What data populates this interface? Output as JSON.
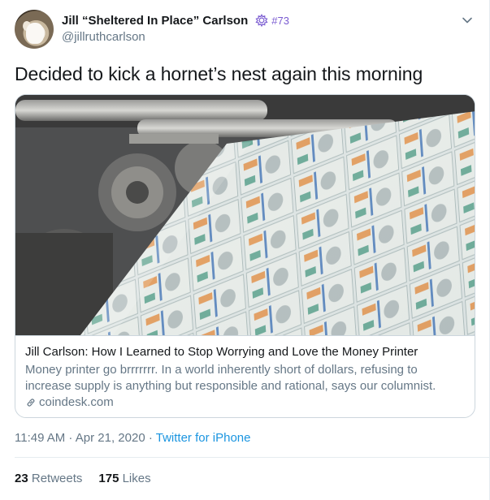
{
  "author": {
    "display_name": "Jill “Sheltered In Place” Carlson",
    "badge_text": "#73",
    "handle": "@jillruthcarlson",
    "badge_icon": "cog-badge-icon",
    "avatar_icon": "dog-avatar"
  },
  "tweet": {
    "text": "Decided to kick a hornet’s nest again this morning"
  },
  "card": {
    "title": "Jill Carlson: How I Learned to Stop Worrying and Love the Money Printer",
    "description": "Money printer go brrrrrrr. In a world inherently short of dollars, refusing to increase supply is anything but responsible and rational, says our columnist.",
    "domain": "coindesk.com",
    "link_icon": "link-icon",
    "image_subject": "money-printing-press"
  },
  "meta": {
    "time": "11:49 AM",
    "separator1": " · ",
    "date": "Apr 21, 2020",
    "separator2": " · ",
    "source": "Twitter for iPhone"
  },
  "stats": {
    "retweets_count": "23",
    "retweets_label": "Retweets",
    "likes_count": "175",
    "likes_label": "Likes"
  },
  "colors": {
    "link_blue": "#1b95e0",
    "secondary_text": "#657786",
    "primary_text": "#14171a",
    "badge_purple": "#7a5bd1"
  }
}
